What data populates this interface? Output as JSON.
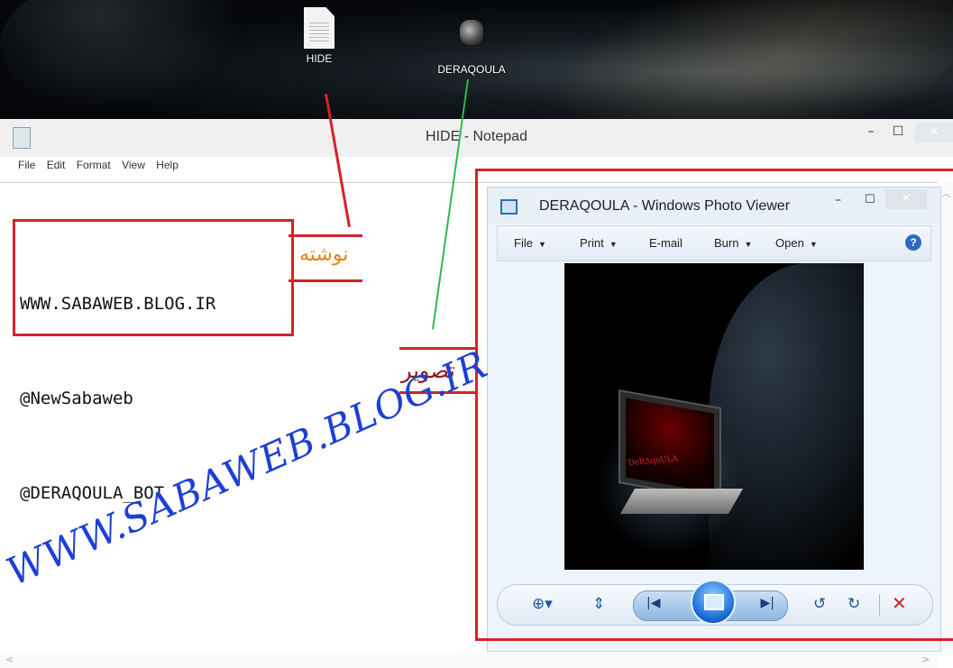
{
  "desktop": {
    "icons": [
      {
        "label": "HIDE",
        "type": "text-file"
      },
      {
        "label": "DERAQOULA",
        "type": "image-file"
      }
    ]
  },
  "notepad": {
    "title": "HIDE - Notepad",
    "menu": [
      "File",
      "Edit",
      "Format",
      "View",
      "Help"
    ],
    "lines": [
      "WWW.SABAWEB.BLOG.IR",
      "@NewSabaweb",
      "@DERAQOULA_BOT"
    ],
    "window_buttons": {
      "minimize": "–",
      "maximize": "☐",
      "close": "×"
    }
  },
  "annotations": {
    "text_label": "نوشته",
    "image_label": "تصویر",
    "watermark": "WWW.SABAWEB.BLOG.IR",
    "colors": {
      "red": "#d3232a",
      "green": "#2db84a",
      "orange": "#e6821e",
      "maroon": "#8b1a1a",
      "watermark": "#1d3fd6"
    }
  },
  "photo_viewer": {
    "title": "DERAQOULA - Windows Photo Viewer",
    "menu": [
      "File",
      "Print",
      "E-mail",
      "Burn",
      "Open"
    ],
    "help": "?",
    "image_caption": "DeRAqoULA",
    "controls": [
      "zoom-icon",
      "actual-size-icon",
      "previous-icon",
      "slideshow-icon",
      "next-icon",
      "rotate-ccw-icon",
      "rotate-cw-icon",
      "delete-icon"
    ]
  }
}
